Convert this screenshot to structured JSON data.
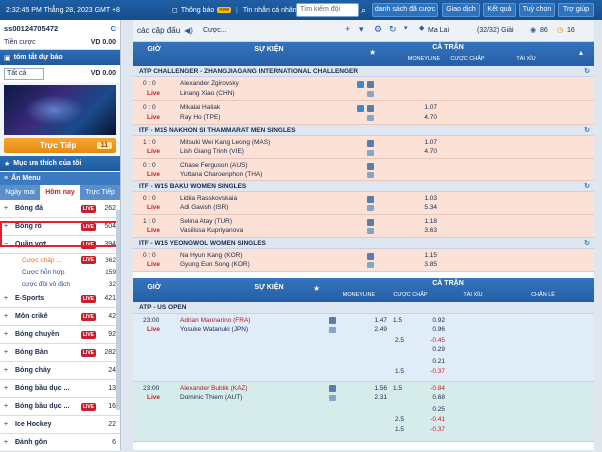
{
  "topbar": {
    "clock": "2:32:45 PM Thẳng 28, 2023 GMT +8",
    "announce": "Thông báo",
    "new_badge": "new",
    "messages": "Tin nhắn cá nhân",
    "search_placeholder": "Tìm kiếm đội",
    "buttons": [
      "danh sách đã cược",
      "Giao dịch",
      "Kết quả",
      "Tuỳ chọn",
      "Trợ giúp"
    ]
  },
  "sidebar": {
    "account": "ss00124705472",
    "refresh": "C",
    "balance_label": "Tiền cược",
    "balance_value": "VD 0.00",
    "summary_title": "tóm tắt dự báo",
    "select_value": "Tất cả",
    "select_amount": "VD 0.00",
    "live_label": "Trực Tiếp",
    "live_count": "11",
    "favorite_label": "Mục ưa thích của tôi",
    "hide_menu": "Ẩn Menu",
    "tabs": [
      "Ngày mai",
      "Hôm nay",
      "Trực Tiếp"
    ],
    "sports": [
      {
        "name": "Bóng đá",
        "live": "LIVE",
        "count": "262"
      },
      {
        "name": "Bóng rổ",
        "live": "LIVE",
        "count": "504"
      },
      {
        "name": "Quần vợt",
        "live": "LIVE",
        "count": "394"
      }
    ],
    "subitems": [
      {
        "name": "Cược chấp ...",
        "live": "LIVE",
        "count": "362"
      },
      {
        "name": "Cược hỗn hợp",
        "count": "159"
      },
      {
        "name": "cược đồi vô địch",
        "count": "32"
      }
    ],
    "sports2": [
      {
        "name": "E-Sports",
        "live": "LIVE",
        "count": "421"
      },
      {
        "name": "Môn crikê",
        "live": "LIVE",
        "count": "42"
      },
      {
        "name": "Bóng chuyền",
        "live": "LIVE",
        "count": "92"
      },
      {
        "name": "Bóng Bàn",
        "live": "LIVE",
        "count": "282"
      },
      {
        "name": "Bóng chày",
        "count": "24"
      },
      {
        "name": "Bóng bầu dục ...",
        "count": "13"
      },
      {
        "name": "Bóng bầu dục ...",
        "live": "LIVE",
        "count": "16"
      },
      {
        "name": "Ice Hockey",
        "count": "22"
      },
      {
        "name": "Đánh gôn",
        "count": "6"
      }
    ]
  },
  "toolbar": {
    "title": "các cặp đấu",
    "mode": "Cược...",
    "market": "Ma Lai",
    "pages": "(32/32) Giải",
    "count1": "86",
    "count2": "16"
  },
  "live_table": {
    "col_time": "GIỜ",
    "col_event": "SỰ KIỆN",
    "col_full": "CẢ TRẬN",
    "col_money": "MONEYLINE",
    "col_hdp": "CƯỢC CHẤP",
    "col_ou": "TÀI XỈU"
  },
  "leagues": [
    {
      "name": "ATP CHALLENGER - ZHANGJIAGANG INTERNATIONAL CHALLENGER",
      "matches": [
        {
          "score": "0 : 0",
          "team1": "Alexander Zgirovsky",
          "team2": "Linang Xiao (CHN)",
          "o1": "",
          "o2": ""
        },
        {
          "score": "0 : 0",
          "team1": "Mikalai Haliak",
          "team2": "Ray Ho (TPE)",
          "o1": "1.07",
          "o2": "4.70"
        }
      ]
    },
    {
      "name": "ITF - M15 NAKHON SI THAMMARAT MEN SINGLES",
      "matches": [
        {
          "score": "1 : 0",
          "team1": "Mitsuki Wei Kang Leong (MAS)",
          "team2": "Lish Giang Trinh (VIE)",
          "o1": "1.07",
          "o2": "4.70"
        },
        {
          "score": "0 : 0",
          "team1": "Chase Ferguson (AUS)",
          "team2": "Yuttana Charoenphon (THA)",
          "o1": "",
          "o2": ""
        }
      ]
    },
    {
      "name": "ITF - W15 BAKU WOMEN SINGLES",
      "matches": [
        {
          "score": "0 : 0",
          "team1": "Lidiia Rasskovskaia",
          "team2": "Adi Gavish (ISR)",
          "o1": "1.03",
          "o2": "5.34"
        },
        {
          "score": "1 : 0",
          "team1": "Selina Atay (TUR)",
          "team2": "Vasilissa Kupriyanova",
          "o1": "1.18",
          "o2": "3.63"
        }
      ]
    },
    {
      "name": "ITF - W15 YEONGWOL WOMEN SINGLES",
      "matches": [
        {
          "score": "0 : 0",
          "team1": "Na Hyun Kang (KOR)",
          "team2": "Gyung Eun Song (KOR)",
          "o1": "1.15",
          "o2": "3.85"
        }
      ]
    }
  ],
  "live_word": "Live",
  "today_table": {
    "col_time": "GIỜ",
    "col_event": "SỰ KIỆN",
    "col_full": "CẢ TRẬN",
    "col_money": "MONEYLINE",
    "col_hdp": "CƯỢC CHẤP",
    "col_ou": "TÀI XỈU",
    "col_oe": "CHẴN LẺ",
    "league": "ATP - US OPEN",
    "m1": {
      "time": "23:00",
      "team1": "Adrian Mannarino (FRA)",
      "team2": "Yosuke Watanuki (JPN)",
      "ml1": "1.47",
      "ml2": "2.49",
      "rows": [
        {
          "h": "1.5",
          "v": "0.92"
        },
        {
          "h": "",
          "v": "0.96"
        },
        {
          "h": "2.5",
          "v": "-0.45"
        },
        {
          "h": "",
          "v": "0.29"
        },
        {
          "h": "",
          "v": "0.21"
        },
        {
          "h": "1.5",
          "v": "-0.37"
        }
      ]
    },
    "m2": {
      "time": "23:00",
      "team1": "Alexander Bublik (KAZ)",
      "team2": "Dominic Thiem (AUT)",
      "ml1": "1.56",
      "ml2": "2.31",
      "rows": [
        {
          "h": "1.5",
          "v": "-0.84"
        },
        {
          "h": "",
          "v": "0.68"
        },
        {
          "h": "",
          "v": "0.25"
        },
        {
          "h": "2.5",
          "v": "-0.41"
        },
        {
          "h": "1.5",
          "v": "-0.37"
        }
      ]
    }
  }
}
